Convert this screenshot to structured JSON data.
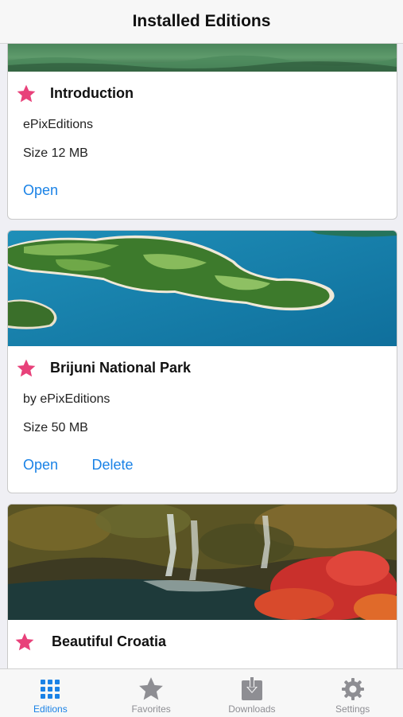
{
  "header": {
    "title": "Installed Editions"
  },
  "editions": [
    {
      "title": "Introduction",
      "publisher": "ePixEditions",
      "size": "Size 12 MB",
      "actions": {
        "open": "Open"
      }
    },
    {
      "title": "Brijuni National Park",
      "publisher": "by ePixEditions",
      "size": "Size 50 MB",
      "actions": {
        "open": "Open",
        "delete": "Delete"
      }
    },
    {
      "title": "Beautiful Croatia"
    }
  ],
  "tabs": [
    {
      "label": "Editions",
      "icon": "grid-icon",
      "active": true
    },
    {
      "label": "Favorites",
      "icon": "star-icon",
      "active": false
    },
    {
      "label": "Downloads",
      "icon": "download-icon",
      "active": false
    },
    {
      "label": "Settings",
      "icon": "gear-icon",
      "active": false
    }
  ],
  "colors": {
    "accent": "#1a82e6",
    "favorite_star": "#e8417a",
    "inactive_tab": "#8e8e93"
  }
}
